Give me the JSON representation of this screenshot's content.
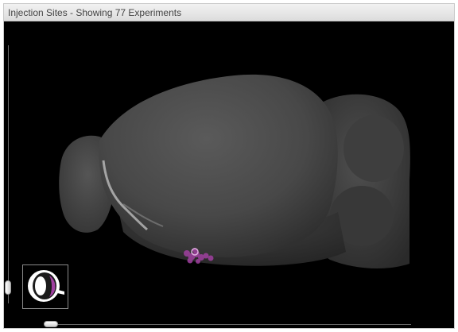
{
  "panel": {
    "title": "Injection Sites - Showing 77 Experiments"
  },
  "viewer": {
    "background": "#000000",
    "brain_color": "#4a4a4a",
    "injection_color": "#a040a0"
  },
  "icons": {
    "orientation": "eye-icon"
  }
}
